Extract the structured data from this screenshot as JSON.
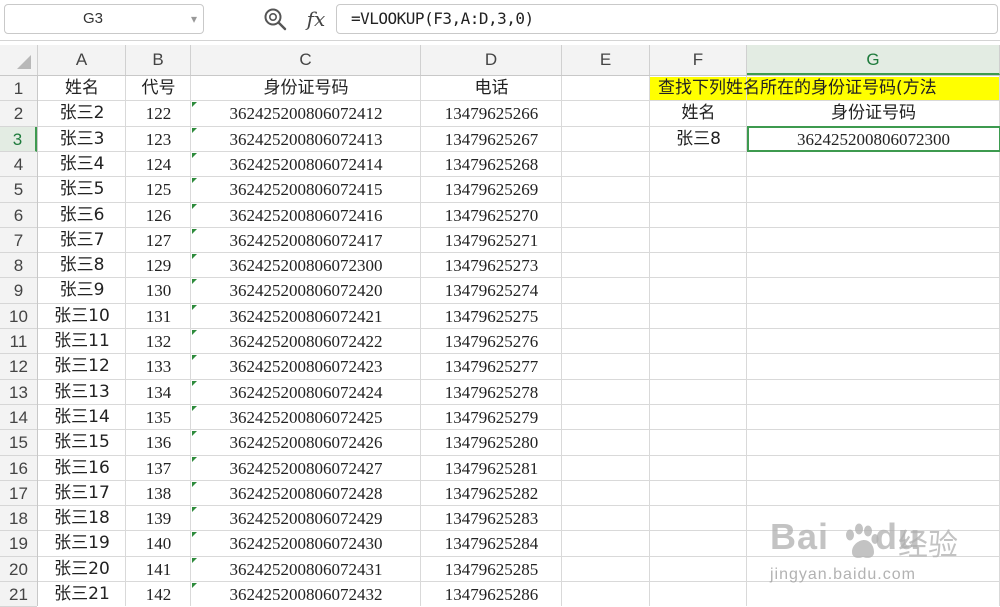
{
  "formula_bar": {
    "name_box": "G3",
    "fx_label": "fx",
    "formula": "=VLOOKUP(F3,A:D,3,0)"
  },
  "columns": [
    "A",
    "B",
    "C",
    "D",
    "E",
    "F",
    "G"
  ],
  "selected_column": "G",
  "selected_row": 3,
  "rows": [
    {
      "n": 1,
      "A": "姓名",
      "B": "代号",
      "C": "身份证号码",
      "D": "电话"
    },
    {
      "n": 2,
      "A": "张三2",
      "B": "122",
      "C": "362425200806072412",
      "D": "13479625266",
      "F": "姓名",
      "G": "身份证号码"
    },
    {
      "n": 3,
      "A": "张三3",
      "B": "123",
      "C": "362425200806072413",
      "D": "13479625267",
      "F": "张三8",
      "G": "362425200806072300"
    },
    {
      "n": 4,
      "A": "张三4",
      "B": "124",
      "C": "362425200806072414",
      "D": "13479625268"
    },
    {
      "n": 5,
      "A": "张三5",
      "B": "125",
      "C": "362425200806072415",
      "D": "13479625269"
    },
    {
      "n": 6,
      "A": "张三6",
      "B": "126",
      "C": "362425200806072416",
      "D": "13479625270"
    },
    {
      "n": 7,
      "A": "张三7",
      "B": "127",
      "C": "362425200806072417",
      "D": "13479625271"
    },
    {
      "n": 8,
      "A": "张三8",
      "B": "129",
      "C": "362425200806072300",
      "D": "13479625273"
    },
    {
      "n": 9,
      "A": "张三9",
      "B": "130",
      "C": "362425200806072420",
      "D": "13479625274"
    },
    {
      "n": 10,
      "A": "张三10",
      "B": "131",
      "C": "362425200806072421",
      "D": "13479625275"
    },
    {
      "n": 11,
      "A": "张三11",
      "B": "132",
      "C": "362425200806072422",
      "D": "13479625276"
    },
    {
      "n": 12,
      "A": "张三12",
      "B": "133",
      "C": "362425200806072423",
      "D": "13479625277"
    },
    {
      "n": 13,
      "A": "张三13",
      "B": "134",
      "C": "362425200806072424",
      "D": "13479625278"
    },
    {
      "n": 14,
      "A": "张三14",
      "B": "135",
      "C": "362425200806072425",
      "D": "13479625279"
    },
    {
      "n": 15,
      "A": "张三15",
      "B": "136",
      "C": "362425200806072426",
      "D": "13479625280"
    },
    {
      "n": 16,
      "A": "张三16",
      "B": "137",
      "C": "362425200806072427",
      "D": "13479625281"
    },
    {
      "n": 17,
      "A": "张三17",
      "B": "138",
      "C": "362425200806072428",
      "D": "13479625282"
    },
    {
      "n": 18,
      "A": "张三18",
      "B": "139",
      "C": "362425200806072429",
      "D": "13479625283"
    },
    {
      "n": 19,
      "A": "张三19",
      "B": "140",
      "C": "362425200806072430",
      "D": "13479625284"
    },
    {
      "n": 20,
      "A": "张三20",
      "B": "141",
      "C": "362425200806072431",
      "D": "13479625285"
    },
    {
      "n": 21,
      "A": "张三21",
      "B": "142",
      "C": "362425200806072432",
      "D": "13479625286"
    }
  ],
  "banner_text": "查找下列姓名所在的身份证号码(方法",
  "banner_color": "#ffff00",
  "selection_color": "#3d9a4f",
  "watermark": {
    "logo": "Bai",
    "logo_suffix": "du",
    "cn": "经验",
    "url": "jingyan.baidu.com"
  }
}
